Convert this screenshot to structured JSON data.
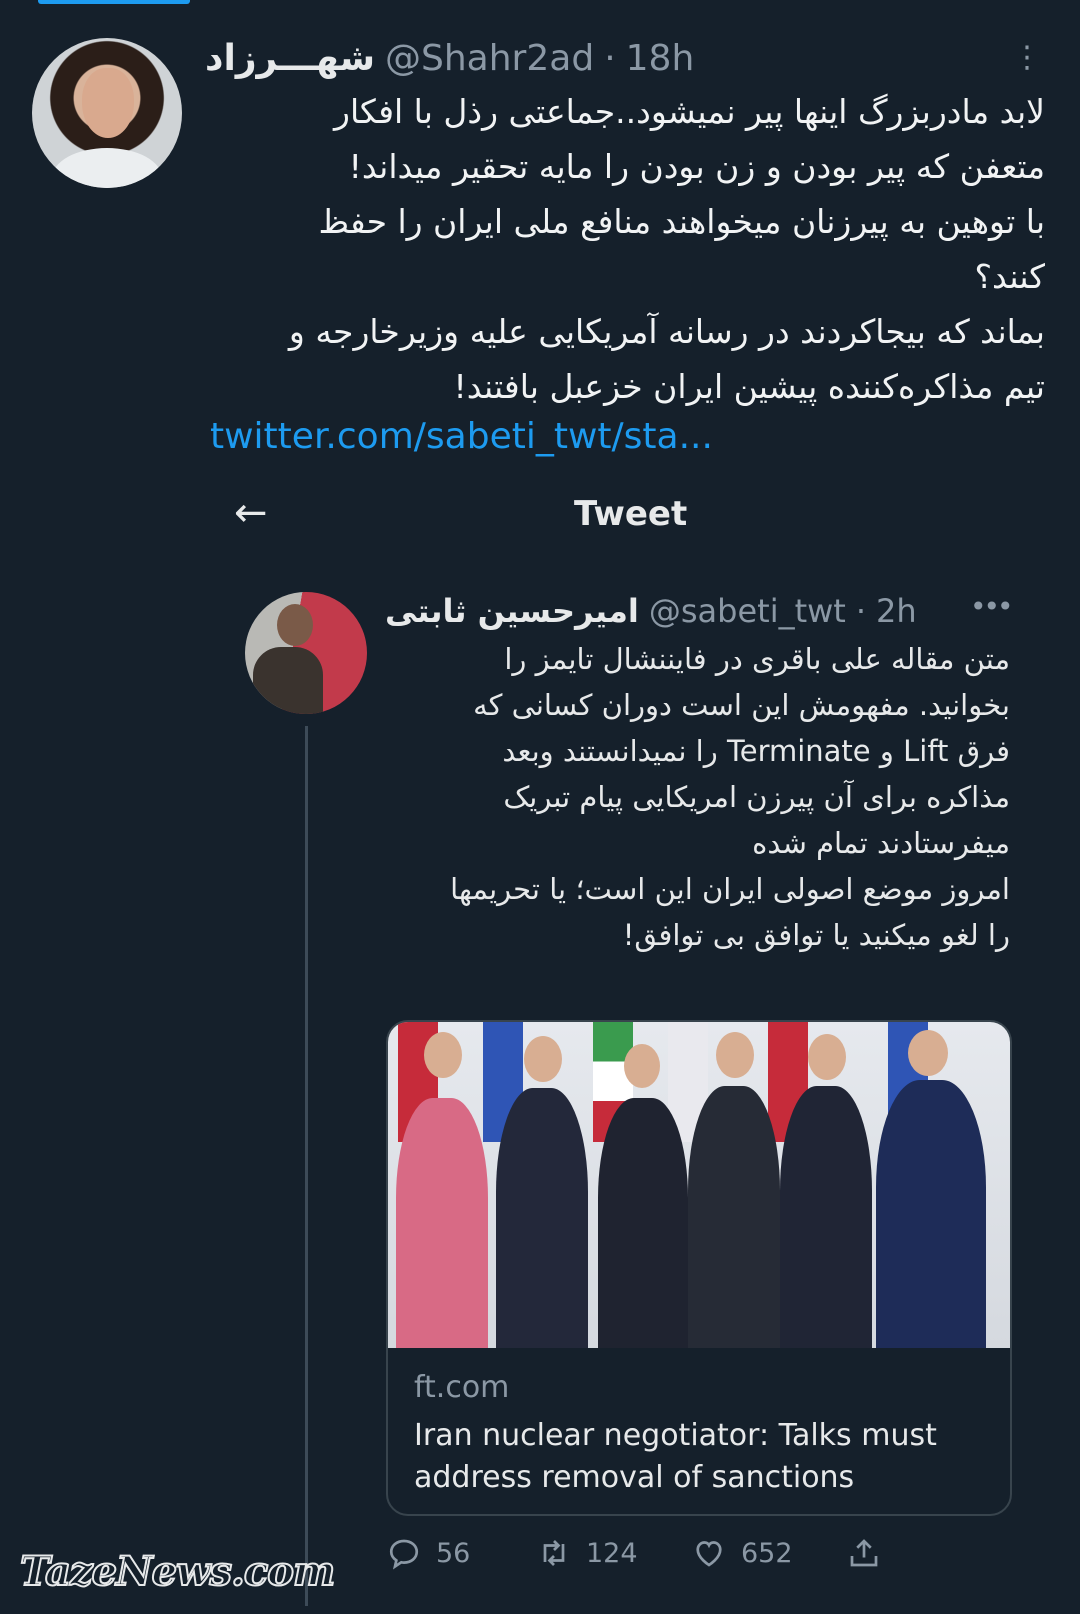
{
  "tweet": {
    "display_name": "شهـــرزاد",
    "handle": "@Shahr2ad",
    "separator": "·",
    "time": "18h",
    "text": "لابد مادربزرگ اینها پیر نمیشود..جماعتی رذل با افکار\nمتعفن که پیر بودن و زن بودن را مایه تحقیر میداند!\nبا توهین به پیرزنان میخواهند منافع ملی ایران را حفظ\nکنند؟\nبماند که بیجاکردند در رسانه آمریکایی علیه وزیرخارجه و\nتیم مذاکره‌کننده پیشین ایران خزعبل بافتند!",
    "link": "twitter.com/sabeti_twt/sta..."
  },
  "embedded": {
    "header_title": "Tweet",
    "display_name": "امیرحسین ثابتی",
    "handle": "@sabeti_twt",
    "separator": "·",
    "time": "2h",
    "text": "متن مقاله علی باقری در فایننشال تایمز را\nبخوانید. مفهومش این است دوران کسانی که\nفرق Lift و Terminate را نمیدانستند وبعد\nمذاکره برای آن پیرزن امریکایی پیام تبریک\nمیفرستادند تمام شده\nامروز موضع اصولی ایران این است؛ یا تحریمها\nرا لغو میکنید یا توافق بی توافق!",
    "card": {
      "domain": "ft.com",
      "title": "Iran nuclear negotiator: Talks must address removal of sanctions"
    },
    "stats": {
      "replies": "56",
      "retweets": "124",
      "likes": "652"
    }
  },
  "watermark": "TazeNews.com",
  "colors": {
    "background": "#15202b",
    "link": "#1d9bf0",
    "muted": "#8b98a5"
  }
}
